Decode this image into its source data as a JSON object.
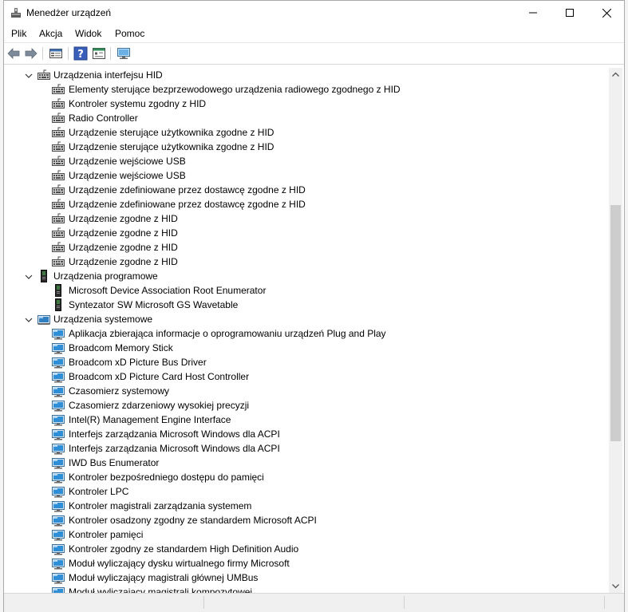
{
  "window": {
    "title": "Menedżer urządzeń",
    "minimize_icon": "minimize-icon",
    "maximize_icon": "maximize-icon",
    "close_icon": "close-icon"
  },
  "menu": [
    "Plik",
    "Akcja",
    "Widok",
    "Pomoc"
  ],
  "toolbar": [
    "back-arrow-icon",
    "forward-arrow-icon",
    "properties-icon",
    "help-icon",
    "show-hidden-icon",
    "monitor-icon"
  ],
  "tree": [
    {
      "label": "Urządzenia interfejsu HID",
      "level": 0,
      "icon": "hid-keyboard-icon",
      "expanded": true
    },
    {
      "label": "Elementy sterujące bezprzewodowego urządzenia radiowego zgodnego z HID",
      "level": 1,
      "icon": "hid-keyboard-icon"
    },
    {
      "label": "Kontroler systemu zgodny z HID",
      "level": 1,
      "icon": "hid-keyboard-icon"
    },
    {
      "label": "Radio Controller",
      "level": 1,
      "icon": "hid-keyboard-icon"
    },
    {
      "label": "Urządzenie sterujące użytkownika zgodne z HID",
      "level": 1,
      "icon": "hid-keyboard-icon"
    },
    {
      "label": "Urządzenie sterujące użytkownika zgodne z HID",
      "level": 1,
      "icon": "hid-keyboard-icon"
    },
    {
      "label": "Urządzenie wejściowe USB",
      "level": 1,
      "icon": "hid-keyboard-icon"
    },
    {
      "label": "Urządzenie wejściowe USB",
      "level": 1,
      "icon": "hid-keyboard-icon"
    },
    {
      "label": "Urządzenie zdefiniowane przez dostawcę zgodne z HID",
      "level": 1,
      "icon": "hid-keyboard-icon"
    },
    {
      "label": "Urządzenie zdefiniowane przez dostawcę zgodne z HID",
      "level": 1,
      "icon": "hid-keyboard-icon"
    },
    {
      "label": "Urządzenie zgodne z HID",
      "level": 1,
      "icon": "hid-keyboard-icon"
    },
    {
      "label": "Urządzenie zgodne z HID",
      "level": 1,
      "icon": "hid-keyboard-icon"
    },
    {
      "label": "Urządzenie zgodne z HID",
      "level": 1,
      "icon": "hid-keyboard-icon"
    },
    {
      "label": "Urządzenie zgodne z HID",
      "level": 1,
      "icon": "hid-keyboard-icon"
    },
    {
      "label": "Urządzenia programowe",
      "level": 0,
      "icon": "software-device-icon",
      "expanded": true
    },
    {
      "label": "Microsoft Device Association Root Enumerator",
      "level": 1,
      "icon": "software-device-icon"
    },
    {
      "label": "Syntezator SW Microsoft GS Wavetable",
      "level": 1,
      "icon": "software-device-icon"
    },
    {
      "label": "Urządzenia systemowe",
      "level": 0,
      "icon": "system-folder-icon",
      "expanded": true
    },
    {
      "label": "Aplikacja zbierająca informacje o oprogramowaniu urządzeń Plug and Play",
      "level": 1,
      "icon": "system-device-icon"
    },
    {
      "label": "Broadcom Memory Stick",
      "level": 1,
      "icon": "system-device-icon"
    },
    {
      "label": "Broadcom xD Picture Bus Driver",
      "level": 1,
      "icon": "system-device-icon"
    },
    {
      "label": "Broadcom xD Picture Card Host Controller",
      "level": 1,
      "icon": "system-device-icon"
    },
    {
      "label": "Czasomierz systemowy",
      "level": 1,
      "icon": "system-device-icon"
    },
    {
      "label": "Czasomierz zdarzeniowy wysokiej precyzji",
      "level": 1,
      "icon": "system-device-icon"
    },
    {
      "label": "Intel(R) Management Engine Interface",
      "level": 1,
      "icon": "system-device-icon"
    },
    {
      "label": "Interfejs zarządzania Microsoft Windows dla ACPI",
      "level": 1,
      "icon": "system-device-icon"
    },
    {
      "label": "Interfejs zarządzania Microsoft Windows dla ACPI",
      "level": 1,
      "icon": "system-device-icon"
    },
    {
      "label": "IWD Bus Enumerator",
      "level": 1,
      "icon": "system-device-icon"
    },
    {
      "label": "Kontroler bezpośredniego dostępu do pamięci",
      "level": 1,
      "icon": "system-device-icon"
    },
    {
      "label": "Kontroler LPC",
      "level": 1,
      "icon": "system-device-icon"
    },
    {
      "label": "Kontroler magistrali zarządzania systemem",
      "level": 1,
      "icon": "system-device-icon"
    },
    {
      "label": "Kontroler osadzony zgodny ze standardem Microsoft ACPI",
      "level": 1,
      "icon": "system-device-icon"
    },
    {
      "label": "Kontroler pamięci",
      "level": 1,
      "icon": "system-device-icon"
    },
    {
      "label": "Kontroler zgodny ze standardem High Definition Audio",
      "level": 1,
      "icon": "system-device-icon"
    },
    {
      "label": "Moduł wyliczający dysku wirtualnego firmy Microsoft",
      "level": 1,
      "icon": "system-device-icon"
    },
    {
      "label": "Moduł wyliczający magistrali głównej UMBus",
      "level": 1,
      "icon": "system-device-icon"
    },
    {
      "label": "Moduł wyliczający magistrali kompozytowej",
      "level": 1,
      "icon": "system-device-icon"
    }
  ]
}
